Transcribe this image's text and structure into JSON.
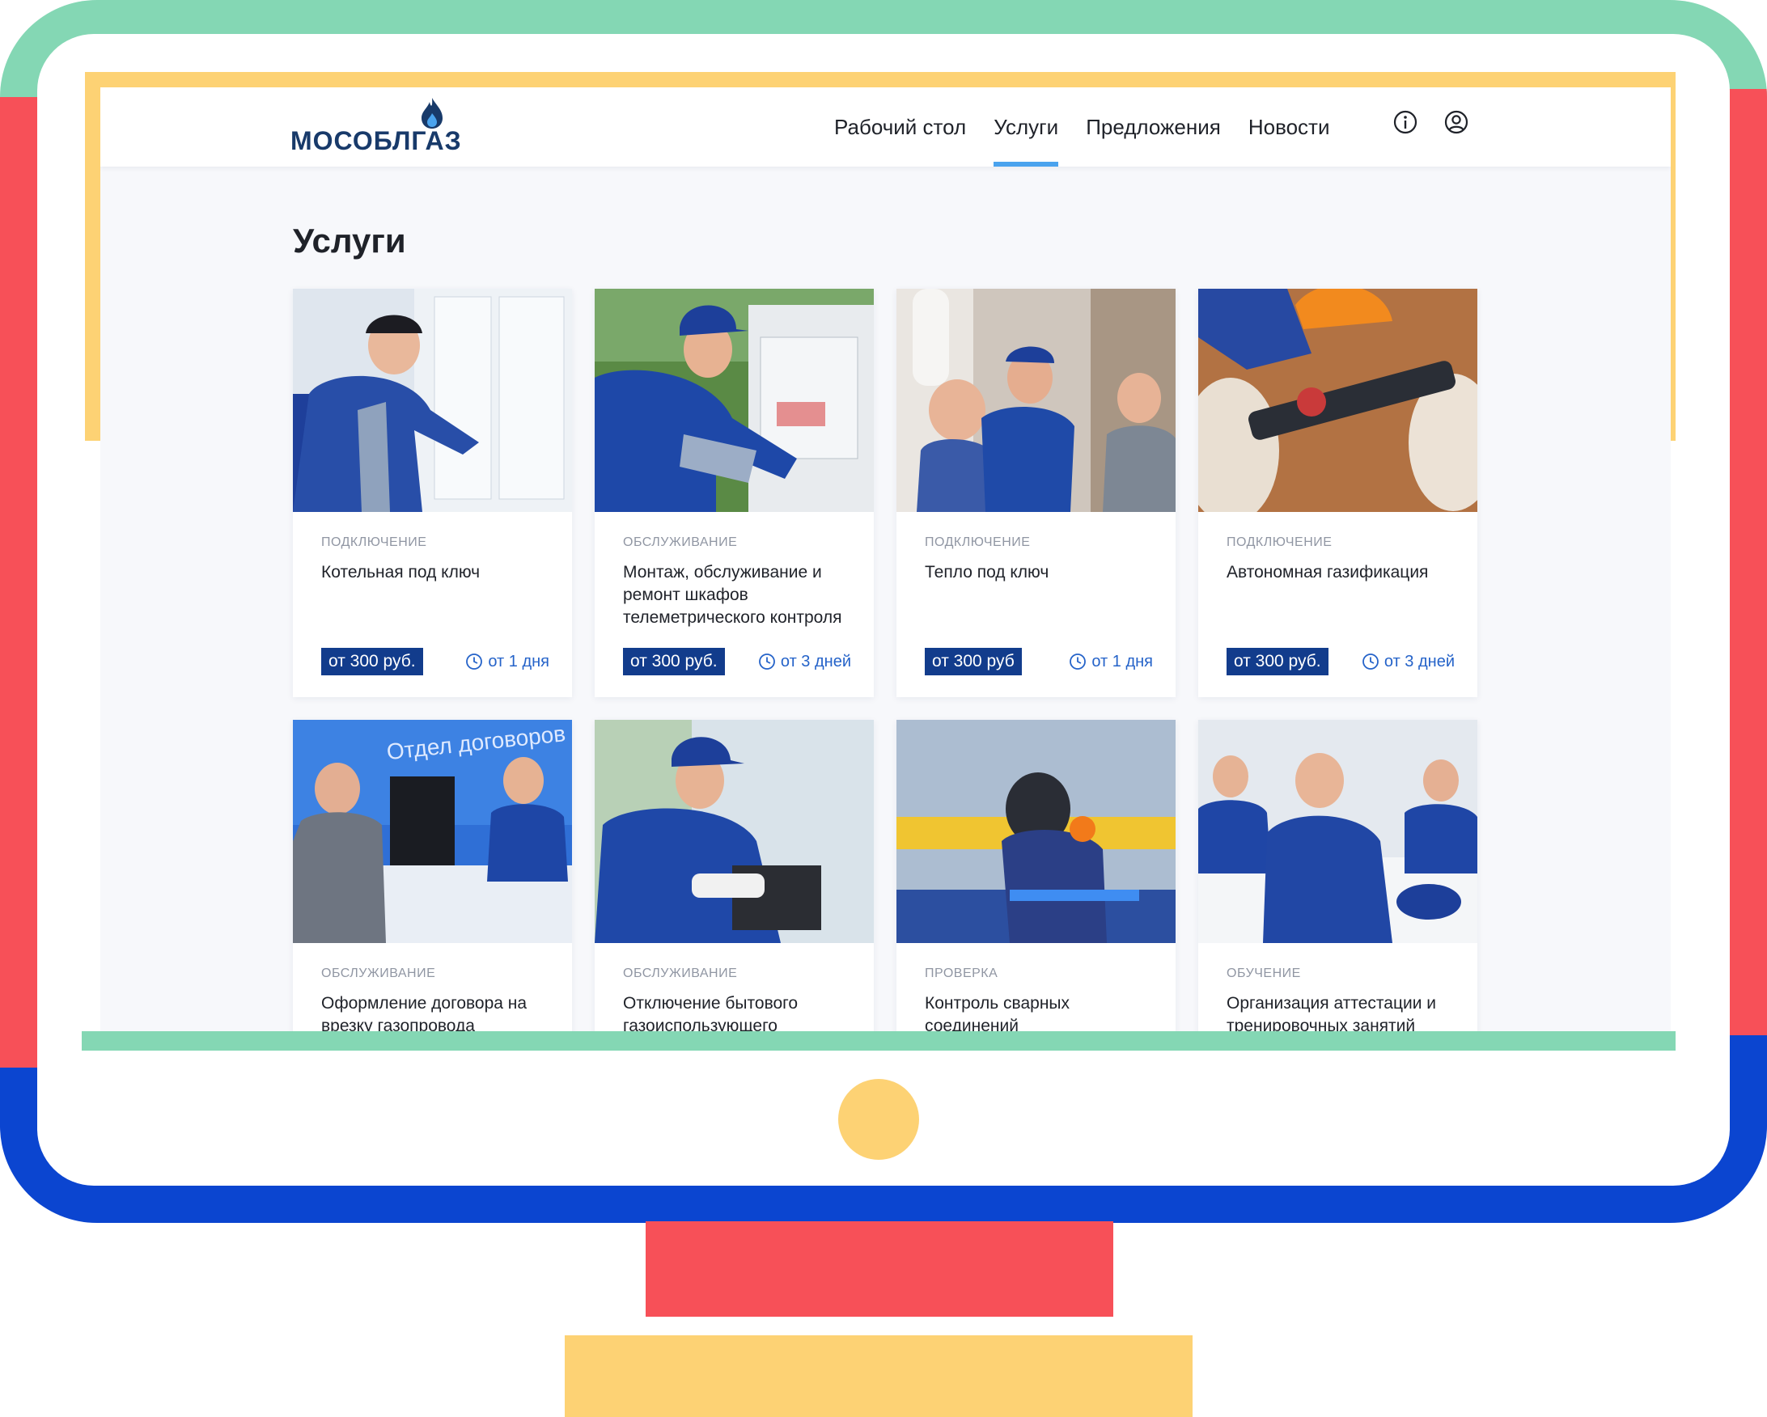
{
  "app": {
    "brand": "МОСОБЛГАЗ",
    "nav": [
      {
        "label": "Рабочий стол",
        "active": false
      },
      {
        "label": "Услуги",
        "active": true
      },
      {
        "label": "Предложения",
        "active": false
      },
      {
        "label": "Новости",
        "active": false
      }
    ],
    "icons": [
      "info-icon",
      "user-icon"
    ]
  },
  "page": {
    "title": "Услуги"
  },
  "services": [
    {
      "category": "Подключение",
      "title": "Котельная под ключ",
      "price": "от 300 руб.",
      "duration": "от 1 дня"
    },
    {
      "category": "Обслуживание",
      "title": "Монтаж, обслуживание и ремонт шкафов телеметрического контроля",
      "price": "от 300 руб.",
      "duration": "от 3 дней"
    },
    {
      "category": "Подключение",
      "title": "Тепло под ключ",
      "price": "от 300 руб",
      "duration": "от 1 дня"
    },
    {
      "category": "Подключение",
      "title": "Автономная газификация",
      "price": "от 300 руб.",
      "duration": "от 3 дней"
    },
    {
      "category": "Обслуживание",
      "title": "Оформление договора на врезку газопровода"
    },
    {
      "category": "Обслуживание",
      "title": "Отключение бытового газоиспользующего"
    },
    {
      "category": "Проверка",
      "title": "Контроль сварных соединений"
    },
    {
      "category": "Обучение",
      "title": "Организация аттестации и тренировочных занятий"
    }
  ],
  "photo_texts": {
    "office_sign": "Отдел договоров"
  },
  "colors": {
    "brand_dark": "#183a6a",
    "accent_blue": "#4aa3ee",
    "price_badge": "#123c8c",
    "duration_text": "#2563c9",
    "frame_green": "#84d7b4",
    "frame_red": "#f75058",
    "frame_yellow": "#fdd274",
    "frame_blue": "#0b45d0"
  }
}
